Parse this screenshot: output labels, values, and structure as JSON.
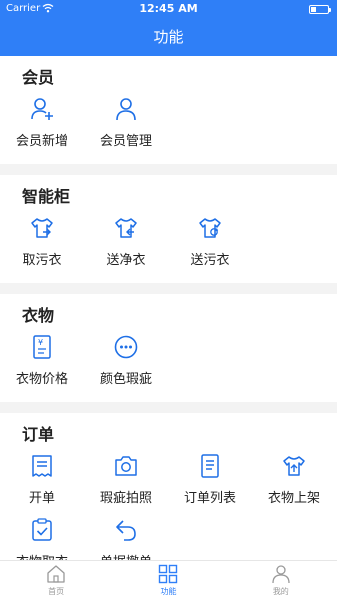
{
  "status": {
    "carrier": "Carrier",
    "time": "12:45 AM"
  },
  "header": {
    "title": "功能"
  },
  "sections": [
    {
      "title": "会员",
      "items": [
        {
          "label": "会员新增",
          "icon": "add-user-icon"
        },
        {
          "label": "会员管理",
          "icon": "user-icon"
        }
      ]
    },
    {
      "title": "智能柜",
      "items": [
        {
          "label": "取污衣",
          "icon": "shirt-out-icon"
        },
        {
          "label": "送净衣",
          "icon": "shirt-in-icon"
        },
        {
          "label": "送污衣",
          "icon": "shirt-refresh-icon"
        }
      ]
    },
    {
      "title": "衣物",
      "items": [
        {
          "label": "衣物价格",
          "icon": "price-tag-icon"
        },
        {
          "label": "颜色瑕疵",
          "icon": "more-circle-icon"
        }
      ]
    },
    {
      "title": "订单",
      "items": [
        {
          "label": "开单",
          "icon": "receipt-icon"
        },
        {
          "label": "瑕疵拍照",
          "icon": "camera-icon"
        },
        {
          "label": "订单列表",
          "icon": "document-icon"
        },
        {
          "label": "衣物上架",
          "icon": "shirt-upload-icon"
        },
        {
          "label": "衣物取衣",
          "icon": "clipboard-check-icon"
        },
        {
          "label": "单据撤单",
          "icon": "undo-icon"
        }
      ]
    }
  ],
  "tabbar": [
    {
      "label": "首页",
      "icon": "home-icon"
    },
    {
      "label": "功能",
      "icon": "grid-icon"
    },
    {
      "label": "我的",
      "icon": "profile-icon"
    }
  ],
  "colors": {
    "accent": "#2f7ff7",
    "icon_blue": "#1e6fe6"
  }
}
